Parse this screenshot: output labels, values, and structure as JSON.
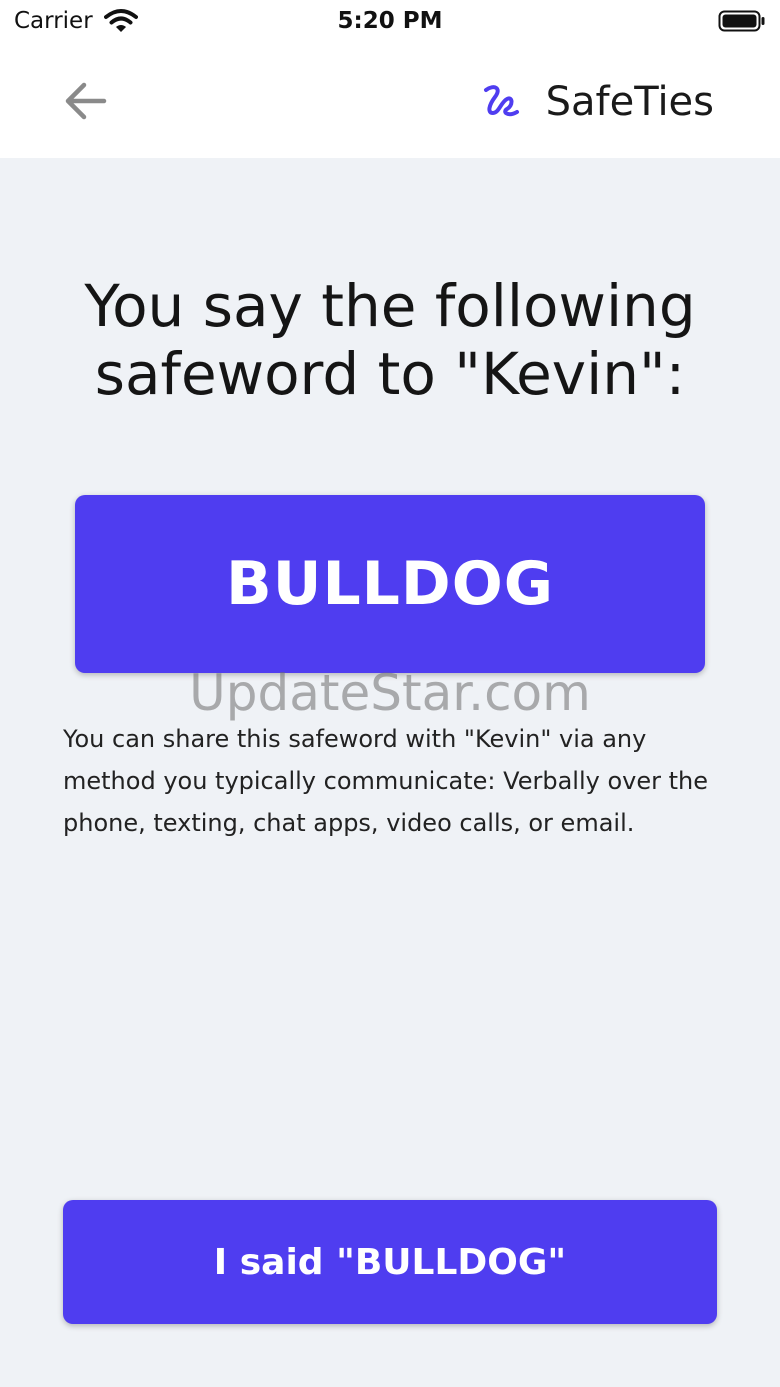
{
  "status_bar": {
    "carrier": "Carrier",
    "time": "5:20 PM",
    "wifi_icon": "wifi-icon",
    "battery_icon": "battery-icon"
  },
  "nav": {
    "back_icon": "arrow-left-icon",
    "brand_logo_icon": "safeties-logo-icon",
    "brand_name": "SafeTies"
  },
  "main": {
    "heading": "You say the following safeword to \"Kevin\":",
    "safeword": "BULLDOG",
    "description": "You can share this safeword with \"Kevin\" via any method you typically communicate: Verbally over the phone, texting, chat apps, video calls, or email.",
    "confirm_button_label": "I said \"BULLDOG\""
  },
  "watermark": "UpdateStar.com",
  "colors": {
    "accent": "#4f3df0",
    "background": "#eff2f6",
    "header": "#ffffff"
  }
}
